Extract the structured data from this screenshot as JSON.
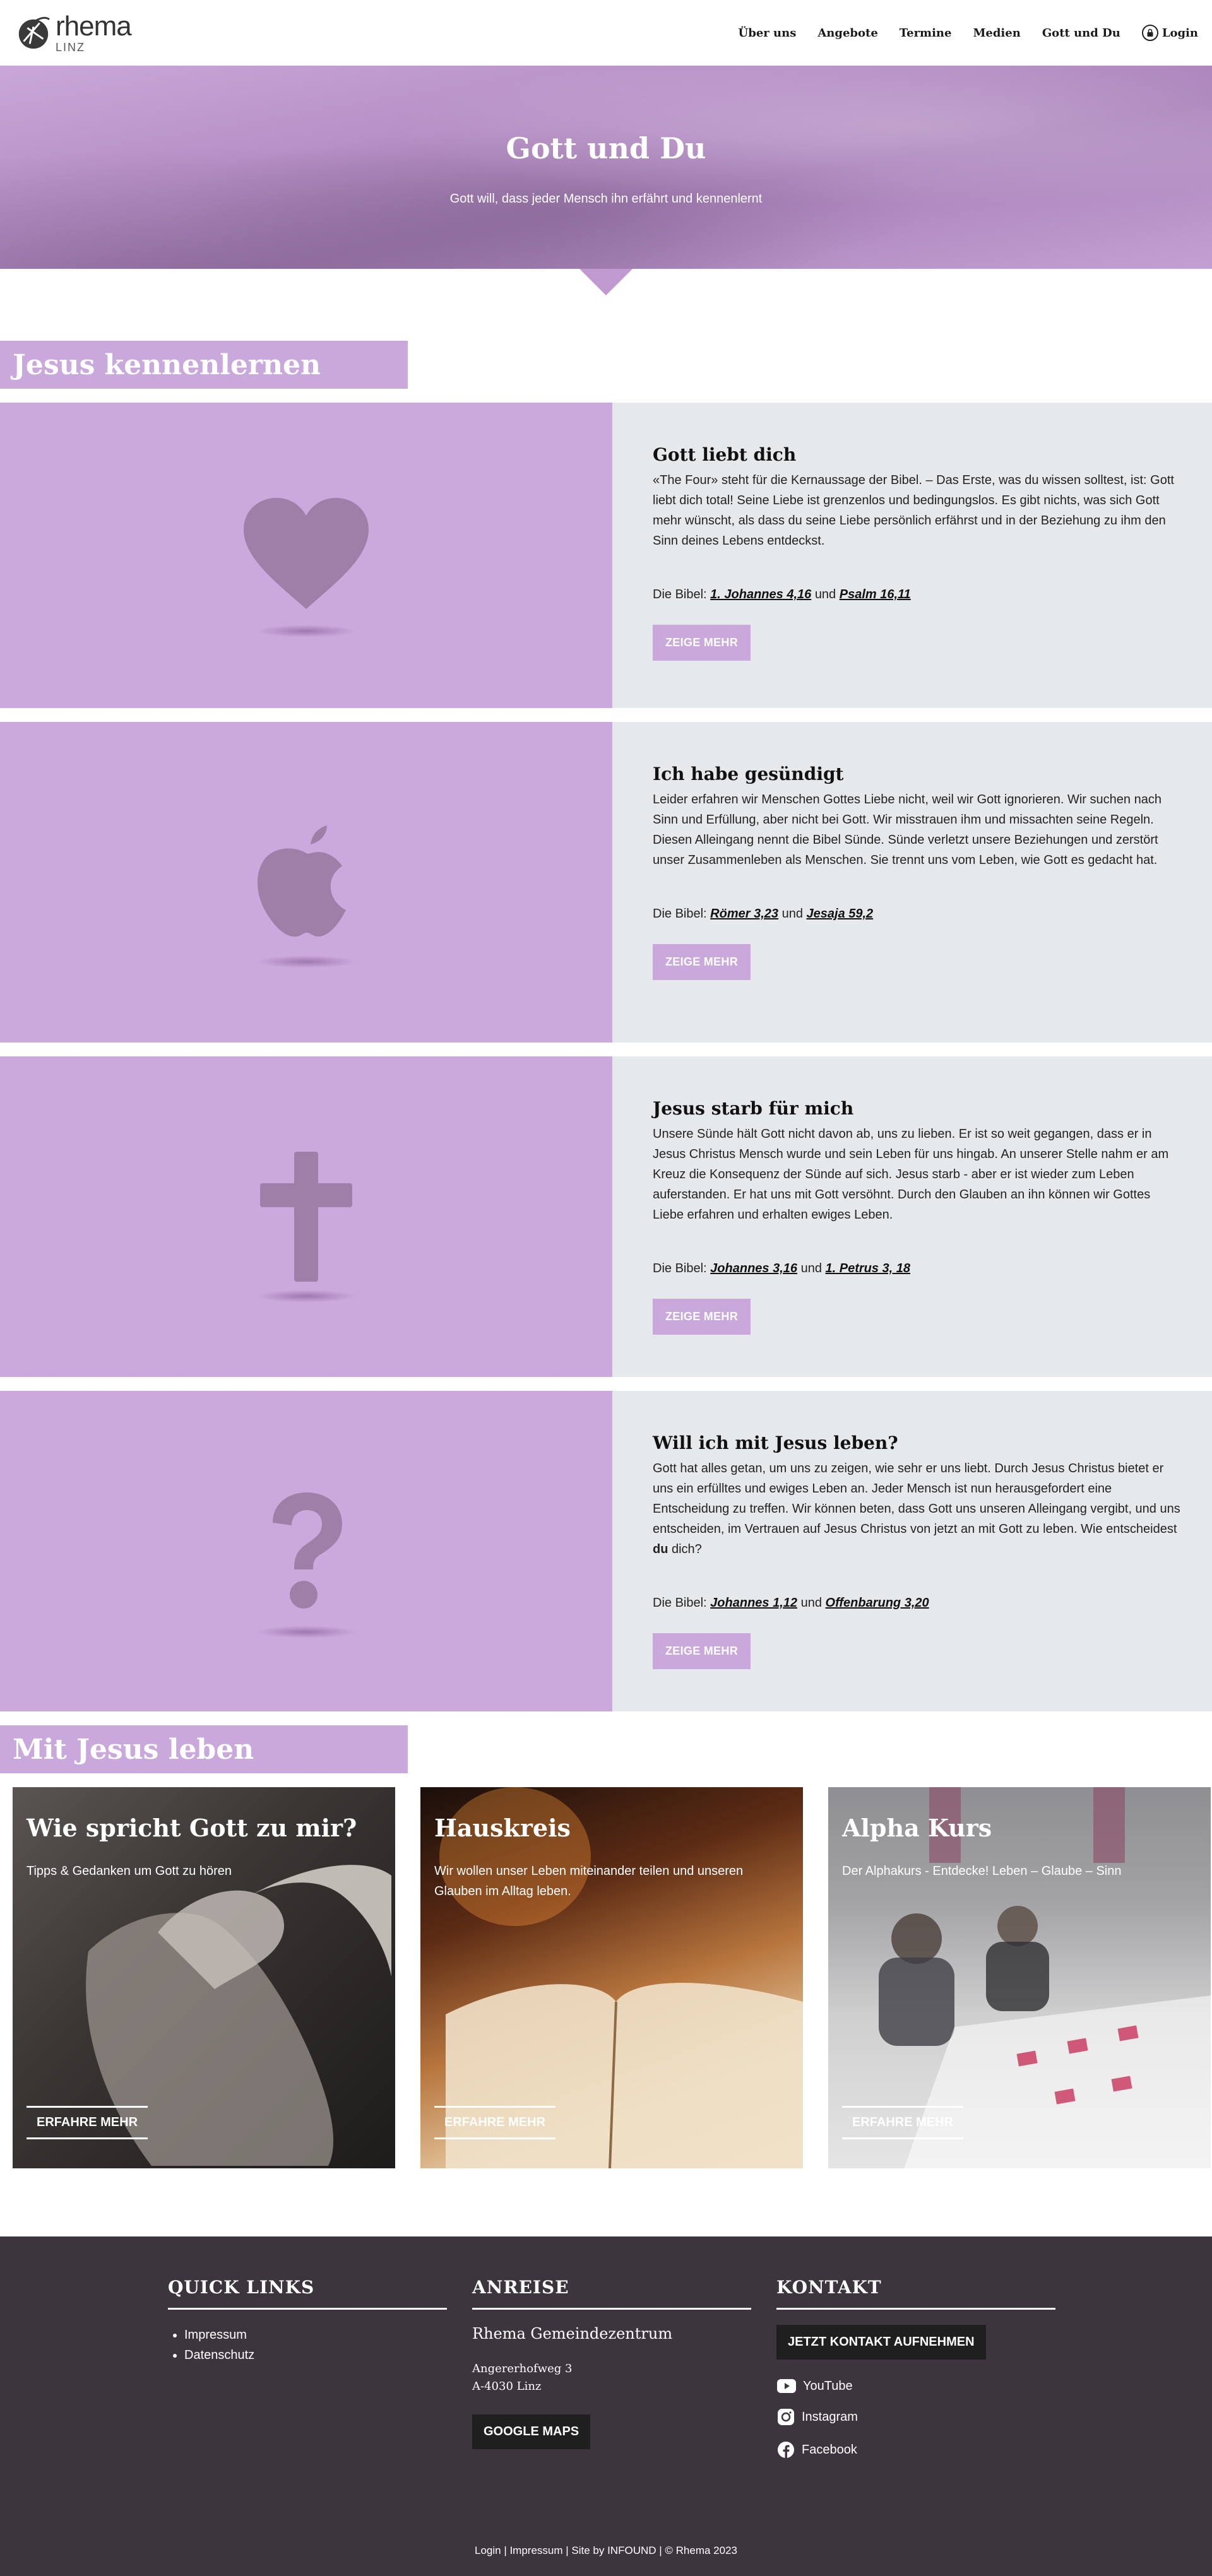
{
  "brand": {
    "name": "rhema",
    "city": "LINZ"
  },
  "nav": [
    {
      "label": "Über uns"
    },
    {
      "label": "Angebote"
    },
    {
      "label": "Termine"
    },
    {
      "label": "Medien"
    },
    {
      "label": "Gott und Du"
    }
  ],
  "login_label": "Login",
  "hero": {
    "title": "Gott und Du",
    "subtitle": "Gott will, dass jeder Mensch ihn erfährt und kennenlernt"
  },
  "section1_title": "Jesus kennenlernen",
  "cards": [
    {
      "icon": "heart-icon",
      "title": "Gott liebt dich",
      "text": "«The Four» steht für die Kernaussage der Bibel. – Das Erste, was du wissen solltest, ist: Gott liebt dich total! Seine Liebe ist grenzenlos und bedingungslos. Es gibt nichts, was sich Gott mehr wünscht, als dass du seine Liebe persönlich erfährst und in der Beziehung zu ihm den Sinn deines Lebens entdeckst.",
      "bible_prefix": "Die Bibel:",
      "ref1": "1. Johannes 4,16",
      "and": "und",
      "ref2": "Psalm 16,11",
      "button": "ZEIGE MEHR"
    },
    {
      "icon": "apple-icon",
      "title": "Ich habe gesündigt",
      "text": "Leider erfahren wir Menschen Gottes Liebe nicht, weil wir Gott ignorieren. Wir suchen nach Sinn und Erfüllung, aber nicht bei Gott. Wir misstrauen ihm und missachten seine Regeln. Diesen Alleingang nennt die Bibel Sünde. Sünde verletzt unsere Beziehungen und zerstört unser Zusammenleben als Menschen. Sie trennt uns vom Leben, wie Gott es gedacht hat.",
      "bible_prefix": "Die Bibel:",
      "ref1": "Römer 3,23",
      "and": "und",
      "ref2": "Jesaja 59,2",
      "button": "ZEIGE MEHR"
    },
    {
      "icon": "cross-icon",
      "title": "Jesus starb für mich",
      "text": "Unsere Sünde hält Gott nicht davon ab, uns zu lieben. Er ist so weit gegangen, dass er in Jesus Christus Mensch wurde und sein Leben für uns hingab. An unserer Stelle nahm er am Kreuz die Konsequenz der Sünde auf sich. Jesus starb - aber er ist wieder zum Leben auferstanden. Er hat uns mit Gott versöhnt. Durch den Glauben an ihn können wir Gottes Liebe erfahren und erhalten ewiges Leben.",
      "bible_prefix": "Die Bibel:",
      "ref1": "Johannes 3,16",
      "and": "und",
      "ref2": "1. Petrus 3, 18",
      "button": "ZEIGE MEHR"
    },
    {
      "icon": "question-icon",
      "title": "Will ich mit Jesus leben?",
      "text_before": "Gott hat alles getan, um uns zu zeigen, wie sehr er uns liebt. Durch Jesus Christus bietet er uns ein erfülltes und ewiges Leben an. Jeder Mensch ist nun herausgefordert eine Entscheidung zu treffen. Wir können beten, dass Gott uns unseren Alleingang vergibt, und uns entscheiden, im Vertrauen auf Jesus Christus von jetzt an mit Gott zu leben. Wie entscheidest ",
      "text_bold": "du",
      "text_after": " dich?",
      "bible_prefix": "Die Bibel:",
      "ref1": "Johannes 1,12",
      "and": "und",
      "ref2": "Offenbarung 3,20",
      "button": "ZEIGE MEHR"
    }
  ],
  "section2_title": "Mit Jesus leben",
  "tiles": [
    {
      "title": "Wie spricht Gott zu mir?",
      "text": "Tipps & Gedanken um Gott zu hören",
      "button": "ERFAHRE MEHR"
    },
    {
      "title": "Hauskreis",
      "text": "Wir wollen unser Leben miteinander teilen und unseren Glauben im Alltag leben.",
      "button": "ERFAHRE MEHR"
    },
    {
      "title": "Alpha Kurs",
      "text": "Der Alphakurs - Entdecke! Leben – Glaube – Sinn",
      "button": "ERFAHRE MEHR"
    }
  ],
  "footer": {
    "quicklinks_title": "QUICK LINKS",
    "quicklinks": [
      "Impressum",
      "Datenschutz"
    ],
    "anreise_title": "ANREISE",
    "venue": "Rhema Gemeindezentrum",
    "street": "Angererhofweg 3",
    "zip_city": "A-4030 Linz",
    "maps_button": "GOOGLE MAPS",
    "kontakt_title": "KONTAKT",
    "contact_button": "JETZT KONTAKT AUFNEHMEN",
    "socials": [
      {
        "label": "YouTube",
        "icon": "youtube-icon"
      },
      {
        "label": "Instagram",
        "icon": "instagram-icon"
      },
      {
        "label": "Facebook",
        "icon": "facebook-icon"
      }
    ],
    "bottom": "Login | Impressum |  Site by INFOUND | © Rhema 2023"
  },
  "colors": {
    "lavender": "#c9a8dc",
    "icon": "#9e7fa8",
    "card_bg": "#e6e9ec",
    "footer_bg": "#3d353d"
  }
}
